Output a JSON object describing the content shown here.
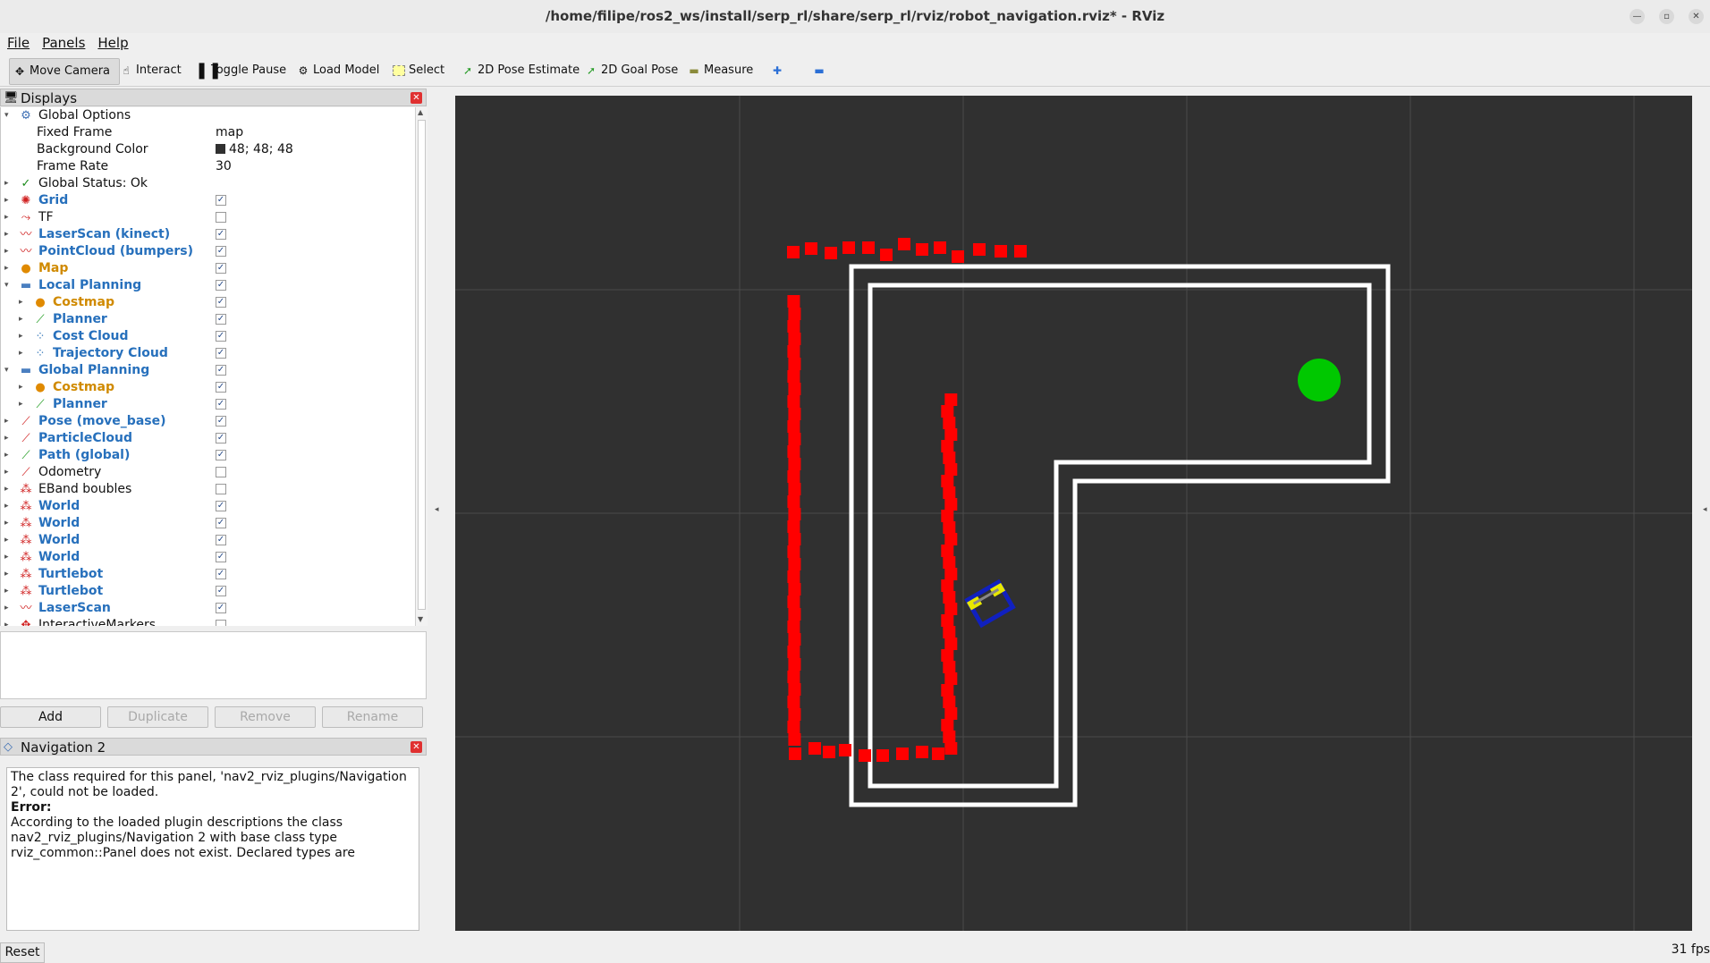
{
  "window": {
    "title": "/home/filipe/ros2_ws/install/serp_rl/share/serp_rl/rviz/robot_navigation.rviz* - RViz"
  },
  "menu": [
    "File",
    "Panels",
    "Help"
  ],
  "toolbar": {
    "move_camera": "Move Camera",
    "interact": "Interact",
    "toggle_pause": "Toggle Pause",
    "load_model": "Load Model",
    "select": "Select",
    "pose_estimate": "2D Pose Estimate",
    "goal_pose": "2D Goal Pose",
    "measure": "Measure",
    "plus_icon": "plus-icon",
    "minus_icon": "minus-icon"
  },
  "displays_panel": {
    "title": "Displays",
    "global_options": {
      "label": "Global Options",
      "fixed_frame_label": "Fixed Frame",
      "fixed_frame_value": "map",
      "background_color_label": "Background Color",
      "background_color_value": "48; 48; 48",
      "background_color_hex": "#303030",
      "frame_rate_label": "Frame Rate",
      "frame_rate_value": "30"
    },
    "global_status": "Global Status: Ok",
    "items": [
      {
        "label": "Grid",
        "checked": true,
        "level": 0,
        "style": "disp",
        "expanded": false
      },
      {
        "label": "TF",
        "checked": false,
        "level": 0,
        "style": "plain",
        "expanded": false
      },
      {
        "label": "LaserScan (kinect)",
        "checked": true,
        "level": 0,
        "style": "disp",
        "expanded": false
      },
      {
        "label": "PointCloud (bumpers)",
        "checked": true,
        "level": 0,
        "style": "disp",
        "expanded": false
      },
      {
        "label": "Map",
        "checked": true,
        "level": 0,
        "style": "warn",
        "expanded": false
      },
      {
        "label": "Local Planning",
        "checked": true,
        "level": 0,
        "style": "disp",
        "expanded": true
      },
      {
        "label": "Costmap",
        "checked": true,
        "level": 1,
        "style": "warn",
        "expanded": false
      },
      {
        "label": "Planner",
        "checked": true,
        "level": 1,
        "style": "disp",
        "expanded": false
      },
      {
        "label": "Cost Cloud",
        "checked": true,
        "level": 1,
        "style": "disp",
        "expanded": false
      },
      {
        "label": "Trajectory Cloud",
        "checked": true,
        "level": 1,
        "style": "disp",
        "expanded": false
      },
      {
        "label": "Global Planning",
        "checked": true,
        "level": 0,
        "style": "disp",
        "expanded": true
      },
      {
        "label": "Costmap",
        "checked": true,
        "level": 1,
        "style": "warn",
        "expanded": false
      },
      {
        "label": "Planner",
        "checked": true,
        "level": 1,
        "style": "disp",
        "expanded": false
      },
      {
        "label": "Pose (move_base)",
        "checked": true,
        "level": 0,
        "style": "disp",
        "expanded": false
      },
      {
        "label": "ParticleCloud",
        "checked": true,
        "level": 0,
        "style": "disp",
        "expanded": false
      },
      {
        "label": "Path (global)",
        "checked": true,
        "level": 0,
        "style": "disp",
        "expanded": false
      },
      {
        "label": "Odometry",
        "checked": false,
        "level": 0,
        "style": "plain",
        "expanded": false
      },
      {
        "label": "EBand boubles",
        "checked": false,
        "level": 0,
        "style": "plain",
        "expanded": false
      },
      {
        "label": "World",
        "checked": true,
        "level": 0,
        "style": "disp",
        "expanded": false
      },
      {
        "label": "World",
        "checked": true,
        "level": 0,
        "style": "disp",
        "expanded": false
      },
      {
        "label": "World",
        "checked": true,
        "level": 0,
        "style": "disp",
        "expanded": false
      },
      {
        "label": "World",
        "checked": true,
        "level": 0,
        "style": "disp",
        "expanded": false
      },
      {
        "label": "Turtlebot",
        "checked": true,
        "level": 0,
        "style": "disp",
        "expanded": false
      },
      {
        "label": "Turtlebot",
        "checked": true,
        "level": 0,
        "style": "disp",
        "expanded": false
      },
      {
        "label": "LaserScan",
        "checked": true,
        "level": 0,
        "style": "disp",
        "expanded": false
      },
      {
        "label": "InteractiveMarkers",
        "checked": false,
        "level": 0,
        "style": "plain",
        "expanded": false
      }
    ],
    "buttons": {
      "add": "Add",
      "duplicate": "Duplicate",
      "remove": "Remove",
      "rename": "Rename"
    }
  },
  "navigation_panel": {
    "title": "Navigation 2",
    "message_line1": "The class required for this panel, 'nav2_rviz_plugins/Navigation 2', could not be loaded.",
    "error_label": "Error:",
    "error_text": "According to the loaded plugin descriptions the class nav2_rviz_plugins/Navigation 2 with base class type rviz_common::Panel does not exist. Declared types are"
  },
  "footer": {
    "reset": "Reset",
    "fps": "31 fps"
  },
  "colors": {
    "viewport": "#303030",
    "laser": "#ff0000",
    "goal": "#00c800",
    "wall": "#ffffff",
    "display_text": "#2770bc",
    "warn_text": "#d08a00"
  }
}
